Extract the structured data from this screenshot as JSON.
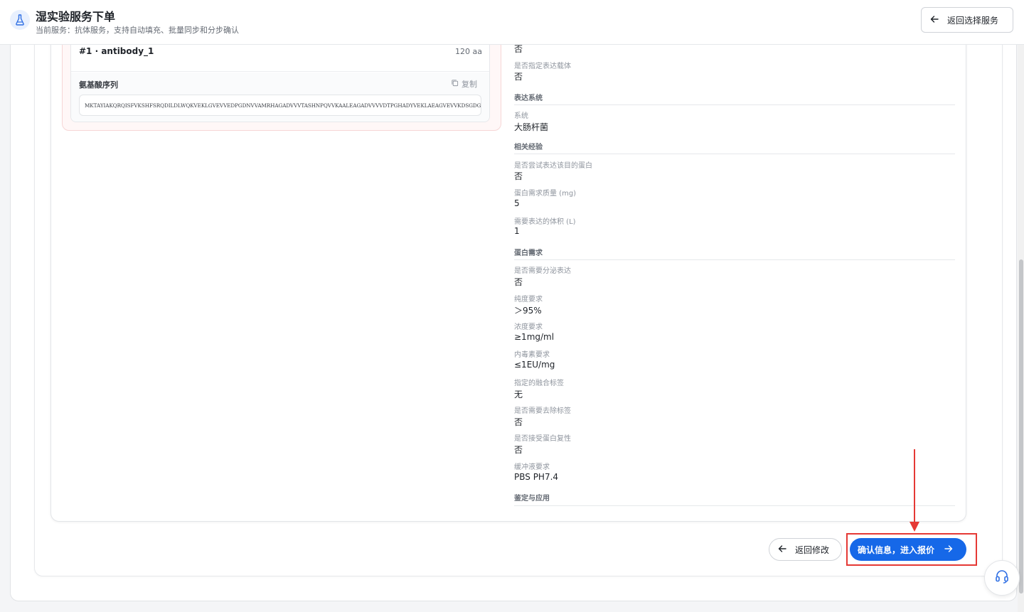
{
  "header": {
    "title": "湿实验服务下单",
    "subtitle": "当前服务：抗体服务，支持自动填充、批量同步和分步确认",
    "back_service_label": "返回选择服务"
  },
  "antibody": {
    "name": "#1 · antibody_1",
    "length": "120 aa",
    "sequence_label": "氨基酸序列",
    "copy_label": "复制",
    "sequence": "MKTAYIAKQRQISFVKSHFSRQDILDLWQKVEKLGVEVVEDPGDNVVAMRHAGADVVVTASHNPQVVKAALEAGADVVVVDTPGHADYVEKLAEAGVEVVKDSGDGVTHVEAVKQLGADK"
  },
  "details": {
    "top_value": "否",
    "vector": {
      "label": "是否指定表达载体",
      "value": "否"
    },
    "expression_section": "表达系统",
    "system": {
      "label": "系统",
      "value": "大肠杆菌"
    },
    "experience_section": "相关经验",
    "tried": {
      "label": "是否尝试表达该目的蛋白",
      "value": "否"
    },
    "mass": {
      "label": "蛋白需求质量 (mg)",
      "value": "5"
    },
    "volume": {
      "label": "需要表达的体积 (L)",
      "value": "1"
    },
    "protein_section": "蛋白需求",
    "secretion": {
      "label": "是否需要分泌表达",
      "value": "否"
    },
    "purity": {
      "label": "纯度要求",
      "value": "＞95%"
    },
    "concentration": {
      "label": "浓度要求",
      "value": "≥1mg/ml"
    },
    "endotoxin": {
      "label": "内毒素要求",
      "value": "≤1EU/mg"
    },
    "fusion_tag": {
      "label": "指定的融合标签",
      "value": "无"
    },
    "remove_tag": {
      "label": "是否需要去除标签",
      "value": "否"
    },
    "refolding": {
      "label": "是否接受蛋白复性",
      "value": "否"
    },
    "buffer": {
      "label": "缓冲液要求",
      "value": "PBS PH7.4"
    },
    "application_section": "鉴定与应用"
  },
  "footer": {
    "back_label": "返回修改",
    "confirm_label": "确认信息，进入报价"
  },
  "colors": {
    "primary": "#1668e8",
    "highlight": "#e53935"
  }
}
